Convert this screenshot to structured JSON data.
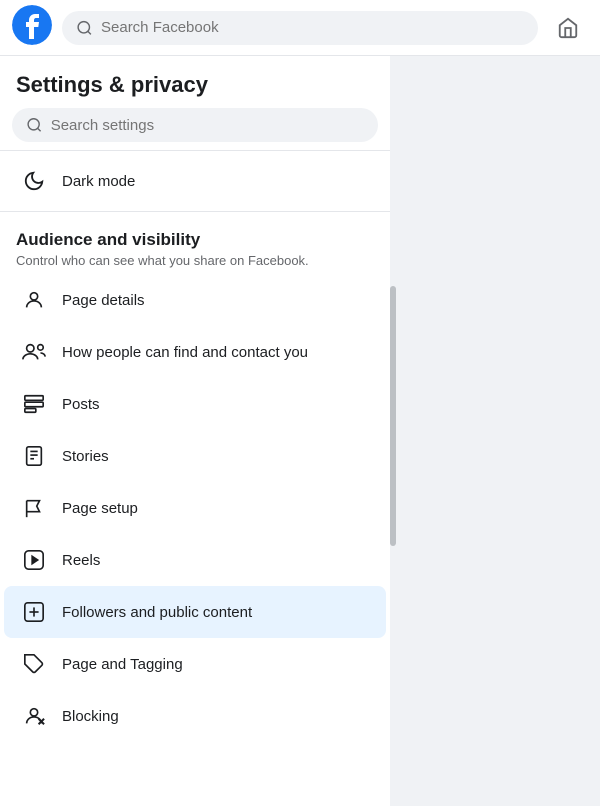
{
  "header": {
    "search_placeholder": "Search Facebook",
    "home_icon": "home-icon"
  },
  "left_panel": {
    "title": "Settings & privacy",
    "settings_search_placeholder": "Search settings",
    "dark_mode_label": "Dark mode",
    "audience_section": {
      "title": "Audience and visibility",
      "subtitle": "Control who can see what you share on Facebook."
    },
    "menu_items": [
      {
        "id": "page-details",
        "label": "Page details",
        "icon": "person-icon"
      },
      {
        "id": "find-contact",
        "label": "How people can find and contact you",
        "icon": "people-icon"
      },
      {
        "id": "posts",
        "label": "Posts",
        "icon": "posts-icon"
      },
      {
        "id": "stories",
        "label": "Stories",
        "icon": "stories-icon"
      },
      {
        "id": "page-setup",
        "label": "Page setup",
        "icon": "flag-icon"
      },
      {
        "id": "reels",
        "label": "Reels",
        "icon": "reels-icon"
      },
      {
        "id": "followers",
        "label": "Followers and public content",
        "icon": "followers-icon",
        "active": true
      },
      {
        "id": "page-tagging",
        "label": "Page and Tagging",
        "icon": "tag-icon"
      },
      {
        "id": "blocking",
        "label": "Blocking",
        "icon": "blocking-icon"
      }
    ]
  }
}
